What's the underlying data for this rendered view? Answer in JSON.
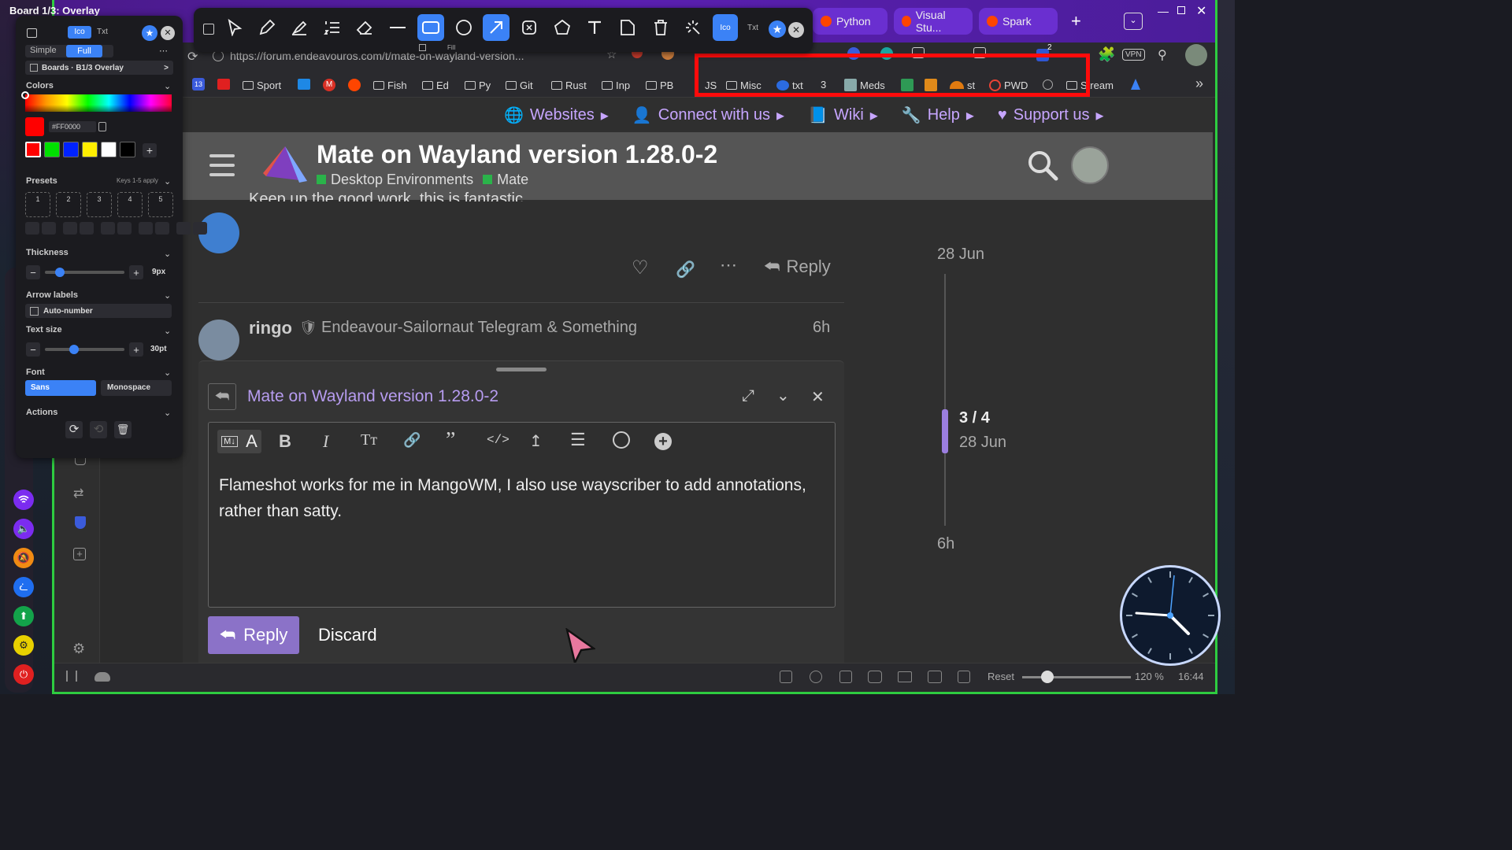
{
  "overlay_title": "Board 1/3: Overlay",
  "browser": {
    "tabs": [
      "Python",
      "Visual Stu...",
      "Spark"
    ],
    "url": "https://forum.endeavouros.com/t/mate-on-wayland-version...",
    "bookmarks": [
      "Sport",
      "Fish",
      "Ed",
      "Py",
      "Git",
      "Rust",
      "Inp",
      "PB",
      "JS",
      "Misc",
      "txt",
      "Meds",
      "st",
      "PWD",
      "Stream"
    ],
    "vpn_label": "VPN",
    "bookmark_badge_13": "13",
    "ext_badge": "2"
  },
  "site": {
    "nav": [
      "Websites",
      "Connect with us",
      "Wiki",
      "Help",
      "Support us"
    ],
    "topic_title": "Mate on Wayland version 1.28.0-2",
    "categories": [
      "Desktop Environments",
      "Mate"
    ],
    "prev_post_text": "Keep up the good work, this is fantastic.",
    "reply_label": "Reply",
    "post_user": "ringo",
    "post_user_title": "Endeavour-Sailornaut Telegram & Something",
    "post_age": "6h",
    "timeline": {
      "top_date": "28 Jun",
      "position": "3 / 4",
      "position_date": "28 Jun",
      "bottom": "6h"
    }
  },
  "composer": {
    "reply_to": "Mate on Wayland version 1.28.0-2",
    "text": "Flameshot works for me in MangoWM, I also use wayscriber to add annotations, rather than satty.",
    "reply_button": "Reply",
    "discard_button": "Discard",
    "md_badge": "M↓"
  },
  "statusbar": {
    "reset_label": "Reset",
    "zoom": "120 %",
    "time": "16:44"
  },
  "wayscriber": {
    "toolbar": {
      "ico_label": "Ico",
      "txt_label": "Txt",
      "fill_label": "Fill"
    },
    "panel": {
      "mode_ico": "Ico",
      "mode_txt": "Txt",
      "view_simple": "Simple",
      "view_full": "Full",
      "boards_label": "Boards · B1/3 Overlay",
      "colors_label": "Colors",
      "hex_value": "#FF0000",
      "swatches": [
        "#ff0000",
        "#00e000",
        "#0022ff",
        "#ffee00",
        "#ffffff",
        "#000000"
      ],
      "presets_label": "Presets",
      "presets_hint": "Keys 1-5 apply",
      "preset_slots": [
        "1",
        "2",
        "3",
        "4",
        "5"
      ],
      "thickness_label": "Thickness",
      "thickness_value": "9px",
      "thickness_fraction": 0.15,
      "arrow_labels_label": "Arrow labels",
      "auto_number_label": "Auto-number",
      "text_size_label": "Text size",
      "text_size_value": "30pt",
      "text_size_fraction": 0.35,
      "font_label": "Font",
      "font_sans": "Sans",
      "font_mono": "Monospace",
      "actions_label": "Actions"
    }
  },
  "colors": {
    "accent_purple": "#c7a6ff",
    "frame_green": "#2ecc40",
    "highlight_red": "#ff0b0b",
    "tool_blue": "#3b82f6"
  }
}
